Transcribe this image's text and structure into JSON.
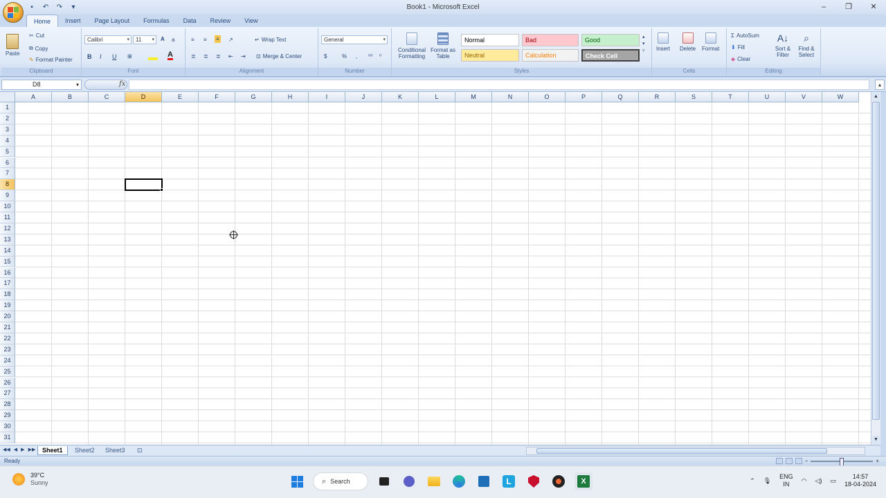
{
  "window": {
    "title": "Book1 - Microsoft Excel",
    "controls": [
      "–",
      "❐",
      "✕"
    ]
  },
  "qat": [
    "save-icon",
    "undo-icon",
    "redo-icon",
    "customize-icon"
  ],
  "tabs": [
    {
      "label": "Home",
      "active": true
    },
    {
      "label": "Insert"
    },
    {
      "label": "Page Layout"
    },
    {
      "label": "Formulas"
    },
    {
      "label": "Data"
    },
    {
      "label": "Review"
    },
    {
      "label": "View"
    }
  ],
  "ribbon": {
    "clipboard": {
      "label": "Clipboard",
      "paste": "Paste",
      "cut": "Cut",
      "copy": "Copy",
      "format_painter": "Format Painter"
    },
    "font": {
      "label": "Font",
      "font_name": "Calibri",
      "font_size": "11",
      "bold": "B",
      "italic": "I",
      "underline": "U"
    },
    "alignment": {
      "label": "Alignment",
      "wrap_text": "Wrap Text",
      "merge_center": "Merge & Center"
    },
    "number": {
      "label": "Number",
      "format": "General",
      "currency": "$",
      "percent": "%",
      "comma": ","
    },
    "styles": {
      "label": "Styles",
      "conditional_formatting": "Conditional Formatting",
      "format_as_table": "Format as Table",
      "cells": [
        {
          "label": "Normal",
          "bg": "#ffffff",
          "fg": "#000000"
        },
        {
          "label": "Bad",
          "bg": "#ffc7ce",
          "fg": "#9c0006"
        },
        {
          "label": "Good",
          "bg": "#c6efce",
          "fg": "#006100"
        },
        {
          "label": "Neutral",
          "bg": "#ffeb9c",
          "fg": "#9c6500"
        },
        {
          "label": "Calculation",
          "bg": "#f2f2f2",
          "fg": "#fa7d00"
        },
        {
          "label": "Check Cell",
          "bg": "#a5a5a5",
          "fg": "#ffffff"
        }
      ]
    },
    "cells": {
      "label": "Cells",
      "insert": "Insert",
      "delete": "Delete",
      "format": "Format"
    },
    "editing": {
      "label": "Editing",
      "autosum": "AutoSum",
      "fill": "Fill",
      "clear": "Clear",
      "sort_filter": "Sort & Filter",
      "find_select": "Find & Select"
    }
  },
  "formula_bar": {
    "name_box": "D8",
    "fx": "fx",
    "value": ""
  },
  "grid": {
    "columns": [
      "A",
      "B",
      "C",
      "D",
      "E",
      "F",
      "G",
      "H",
      "I",
      "J",
      "K",
      "L",
      "M",
      "N",
      "O",
      "P",
      "Q",
      "R",
      "S",
      "T",
      "U",
      "V",
      "W"
    ],
    "rows": [
      "1",
      "2",
      "3",
      "4",
      "5",
      "6",
      "7",
      "8",
      "9",
      "10",
      "11",
      "12",
      "13",
      "14",
      "15",
      "16",
      "17",
      "18",
      "19",
      "20",
      "21",
      "22",
      "23",
      "24",
      "25",
      "26",
      "27",
      "28",
      "29",
      "30",
      "31"
    ],
    "selected_column": "D",
    "selected_row": "8"
  },
  "sheets": [
    {
      "label": "Sheet1",
      "active": true
    },
    {
      "label": "Sheet2"
    },
    {
      "label": "Sheet3"
    }
  ],
  "status": {
    "text": "Ready"
  },
  "taskbar": {
    "weather_temp": "39°C",
    "weather_desc": "Sunny",
    "search_label": "Search",
    "lang_1": "ENG",
    "lang_2": "IN",
    "time": "14:57",
    "date": "18-04-2024"
  },
  "colors": {
    "ribbon_accent": "#15428b",
    "selection": "#f4c45e"
  }
}
